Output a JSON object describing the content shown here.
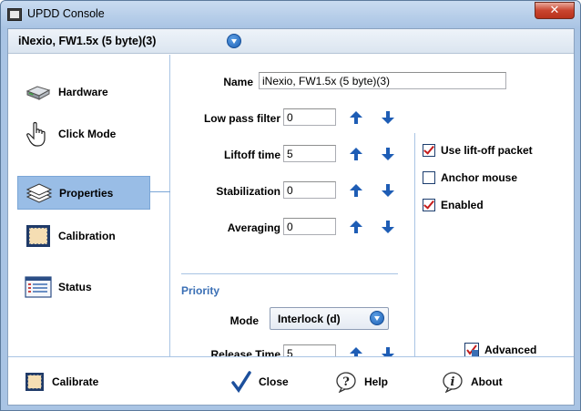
{
  "window": {
    "title": "UPDD Console",
    "close_glyph": "✕"
  },
  "device": {
    "name": "iNexio, FW1.5x (5 byte)(3)"
  },
  "nav": [
    {
      "label": "Hardware",
      "icon": "hardware-icon"
    },
    {
      "label": "Click Mode",
      "icon": "hand-pointer-icon"
    },
    {
      "label": "Properties",
      "icon": "layers-icon",
      "selected": true
    },
    {
      "label": "Calibration",
      "icon": "calibration-icon"
    },
    {
      "label": "Status",
      "icon": "status-icon"
    }
  ],
  "properties": {
    "name_label": "Name",
    "name_value": "iNexio, FW1.5x (5 byte)(3)",
    "low_pass_label": "Low pass filter",
    "low_pass_value": "0",
    "liftoff_label": "Liftoff time",
    "liftoff_value": "5",
    "stabilization_label": "Stabilization",
    "stabilization_value": "0",
    "averaging_label": "Averaging",
    "averaging_value": "0",
    "priority_heading": "Priority",
    "mode_label": "Mode",
    "mode_value": "Interlock (d)",
    "release_label": "Release Time",
    "release_value": "5"
  },
  "options": {
    "use_liftoff": {
      "label": "Use lift-off packet",
      "checked": true
    },
    "anchor_mouse": {
      "label": "Anchor mouse",
      "checked": false
    },
    "enabled": {
      "label": "Enabled",
      "checked": true
    },
    "advanced_label": "Advanced"
  },
  "footer": {
    "calibrate": "Calibrate",
    "close": "Close",
    "help": "Help",
    "about": "About"
  },
  "colors": {
    "accent": "#1e5db5",
    "selection": "#99bde6",
    "frame": "#a9c4e4",
    "check": "#c41d1d"
  }
}
